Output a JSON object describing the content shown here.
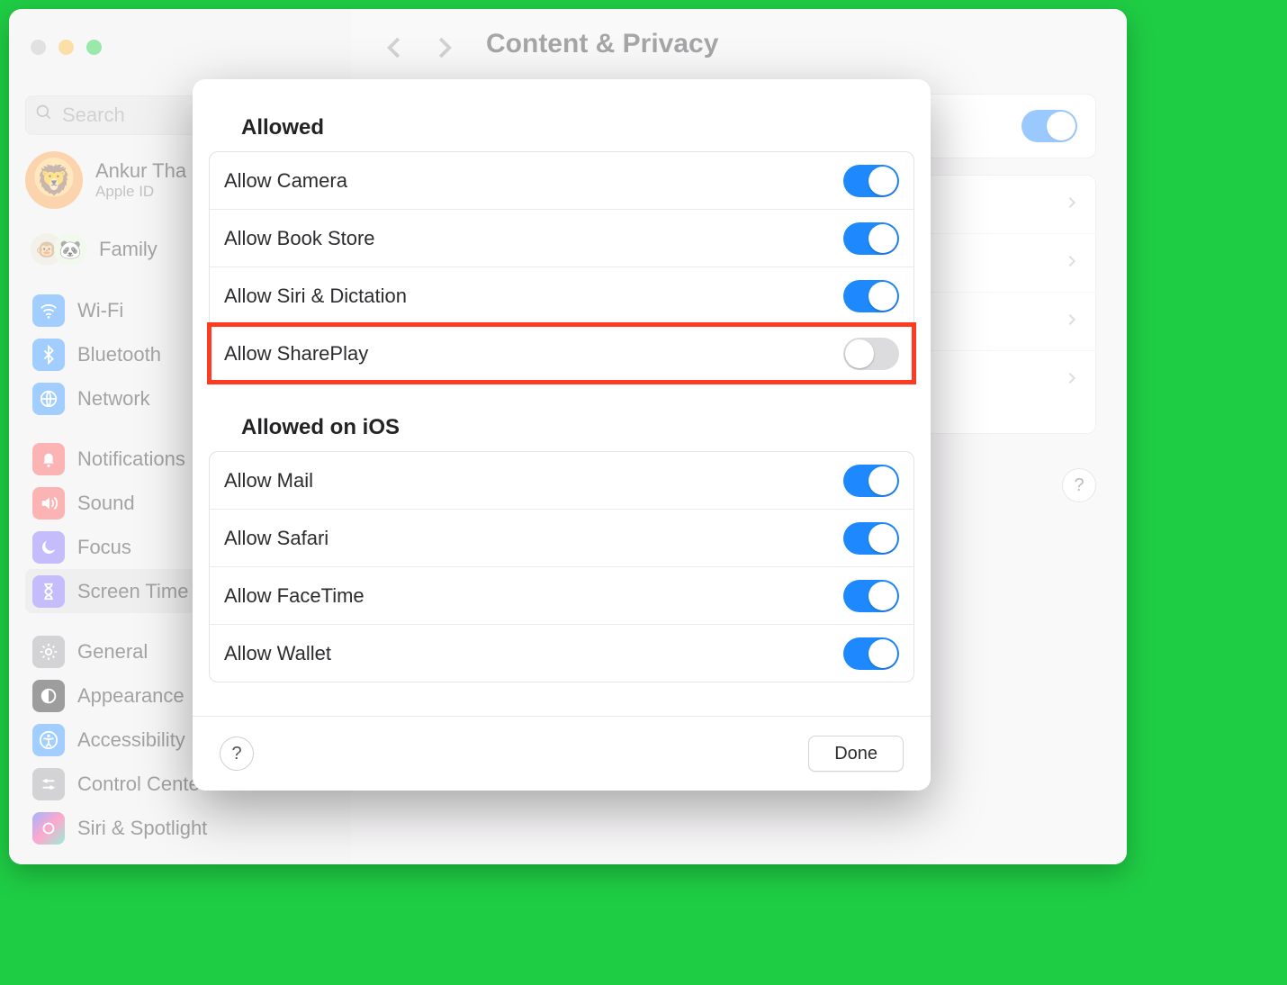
{
  "header": {
    "title": "Content & Privacy"
  },
  "search": {
    "placeholder": "Search"
  },
  "account": {
    "name": "Ankur Tha",
    "sub": "Apple ID",
    "avatar_emoji": "🦁"
  },
  "family": {
    "label": "Family",
    "emoji1": "🐵",
    "emoji2": "🐼"
  },
  "sidebar": {
    "items": [
      {
        "label": "Wi-Fi"
      },
      {
        "label": "Bluetooth"
      },
      {
        "label": "Network"
      },
      {
        "label": "Notifications"
      },
      {
        "label": "Sound"
      },
      {
        "label": "Focus"
      },
      {
        "label": "Screen Time"
      },
      {
        "label": "General"
      },
      {
        "label": "Appearance"
      },
      {
        "label": "Accessibility"
      },
      {
        "label": "Control Cente"
      },
      {
        "label": "Siri & Spotlight"
      }
    ]
  },
  "bg_toggle_on": true,
  "help_glyph": "?",
  "sheet": {
    "section1_title": "Allowed",
    "section1": [
      {
        "label": "Allow Camera",
        "on": true
      },
      {
        "label": "Allow Book Store",
        "on": true
      },
      {
        "label": "Allow Siri & Dictation",
        "on": true
      },
      {
        "label": "Allow SharePlay",
        "on": false,
        "highlight": true
      }
    ],
    "section2_title": "Allowed on iOS",
    "section2": [
      {
        "label": "Allow Mail",
        "on": true
      },
      {
        "label": "Allow Safari",
        "on": true
      },
      {
        "label": "Allow FaceTime",
        "on": true
      },
      {
        "label": "Allow Wallet",
        "on": true
      }
    ],
    "done_label": "Done"
  }
}
